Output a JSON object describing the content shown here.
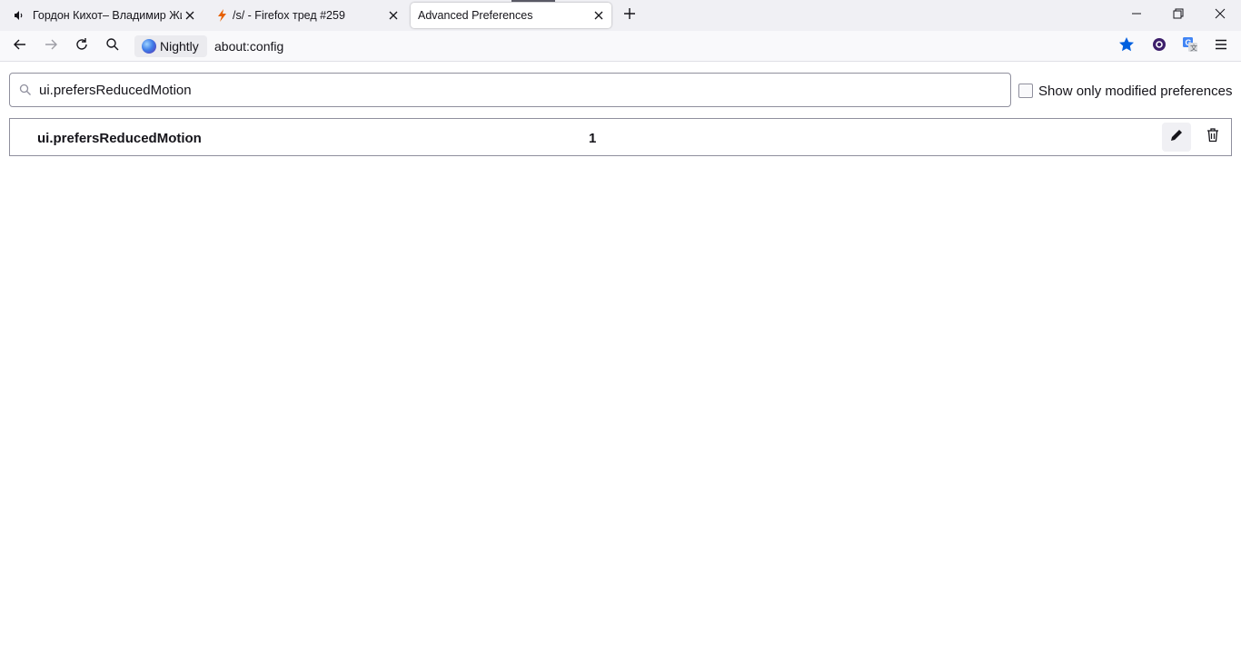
{
  "tabs": [
    {
      "title": "Гордон Кихот– Владимир Жир",
      "icon": "speaker-icon",
      "selected": false
    },
    {
      "title": "/s/ - Firefox тред #259",
      "icon": "lightning-icon",
      "selected": false
    },
    {
      "title": "Advanced Preferences",
      "icon": "",
      "selected": true
    }
  ],
  "navbar": {
    "identity_label": "Nightly",
    "url": "about:config"
  },
  "search": {
    "value": "ui.prefersReducedMotion"
  },
  "modified_toggle": {
    "label": "Show only modified preferences",
    "checked": false
  },
  "preferences": [
    {
      "name": "ui.prefersReducedMotion",
      "value": "1"
    }
  ],
  "colors": {
    "bookmark_star": "#0060df",
    "lightning": "#e66000"
  }
}
